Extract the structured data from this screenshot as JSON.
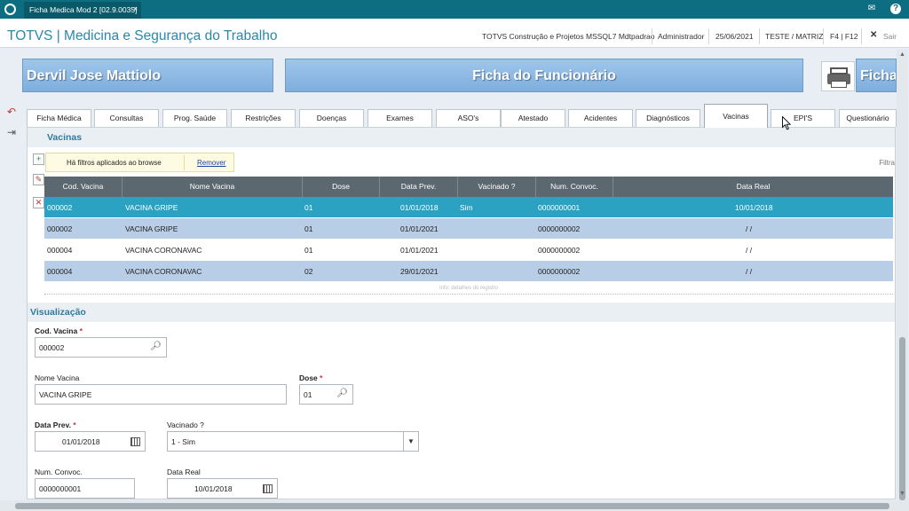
{
  "window": {
    "tab_title": "Ficha Medica Mod 2 [02.9.0035]",
    "close_glyph": "×"
  },
  "app": {
    "title": "TOTVS | Medicina e Segurança do Trabalho",
    "company": "TOTVS Construção e Projetos MSSQL7 Mdtpadrao",
    "user": "Administrador",
    "date": "25/06/2021",
    "branch": "TESTE / MATRIZ",
    "keys": "F4 | F12",
    "exit_label": "Sair"
  },
  "banners": {
    "employee_name": "Dervil Jose Mattiolo",
    "form_title": "Ficha do Funcionário",
    "ficha_label": "Ficha"
  },
  "tabs": [
    "Ficha Médica",
    "Consultas",
    "Prog. Saúde",
    "Restrições",
    "Doenças",
    "Exames",
    "ASO's",
    "Atestado",
    "Acidentes",
    "Diagnósticos",
    "Vacinas",
    "EPI'S",
    "Questionário"
  ],
  "active_tab": "Vacinas",
  "vacinas": {
    "section_title": "Vacinas",
    "filter_msg": "Há filtros aplicados ao browse",
    "remove_link": "Remover",
    "filter_label": "Filtra",
    "columns": [
      "Cod. Vacina",
      "Nome Vacina",
      "Dose",
      "Data Prev.",
      "Vacinado ?",
      "Num. Convoc.",
      "Data Real"
    ],
    "rows": [
      {
        "cod": "000002",
        "nome": "VACINA GRIPE",
        "dose": "01",
        "data_prev": "01/01/2018",
        "vacinado": "Sim",
        "convoc": "0000000001",
        "data_real": "10/01/2018"
      },
      {
        "cod": "000002",
        "nome": "VACINA GRIPE",
        "dose": "01",
        "data_prev": "01/01/2021",
        "vacinado": "",
        "convoc": "0000000002",
        "data_real": "/ /"
      },
      {
        "cod": "000004",
        "nome": "VACINA CORONAVAC",
        "dose": "01",
        "data_prev": "01/01/2021",
        "vacinado": "",
        "convoc": "0000000002",
        "data_real": "/ /"
      },
      {
        "cod": "000004",
        "nome": "VACINA CORONAVAC",
        "dose": "02",
        "data_prev": "29/01/2021",
        "vacinado": "",
        "convoc": "0000000002",
        "data_real": "/ /"
      }
    ],
    "footer_hint": "Info: detalhes do registro"
  },
  "visualizacao": {
    "section_title": "Visualização",
    "cod_vacina_label": "Cod. Vacina",
    "cod_vacina_value": "000002",
    "nome_vacina_label": "Nome Vacina",
    "nome_vacina_value": "VACINA GRIPE",
    "dose_label": "Dose",
    "dose_value": "01",
    "data_prev_label": "Data Prev.",
    "data_prev_value": "01/01/2018",
    "vacinado_label": "Vacinado ?",
    "vacinado_value": "1 - Sim",
    "num_convoc_label": "Num. Convoc.",
    "num_convoc_value": "0000000001",
    "data_real_label": "Data Real",
    "data_real_value": "10/01/2018",
    "required_mark": "*"
  },
  "colors": {
    "accent": "#2ba2c2",
    "header": "#0d6e82",
    "row_alt": "#b8cde6",
    "title": "#2a88a8"
  },
  "icons": [
    "totvs-logo-icon",
    "mail-icon",
    "help-icon",
    "close-icon",
    "undo-icon",
    "exit-icon",
    "add-icon",
    "edit-icon",
    "delete-icon",
    "print-icon",
    "search-icon",
    "calendar-icon",
    "chevron-down-icon",
    "cursor-icon"
  ]
}
